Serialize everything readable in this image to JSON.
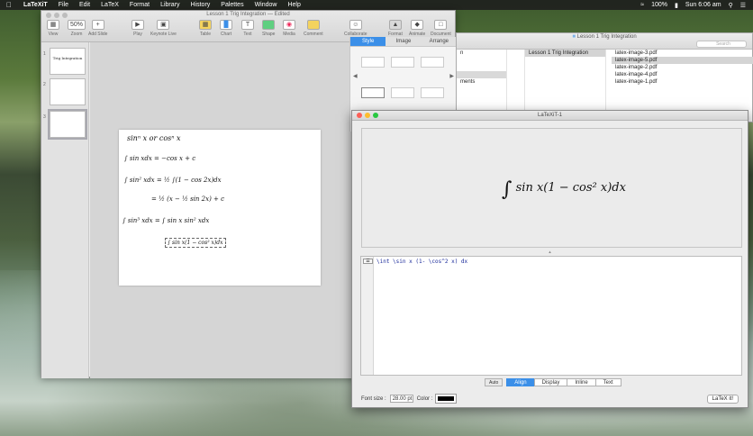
{
  "menubar": {
    "app": "LaTeXiT",
    "items": [
      "File",
      "Edit",
      "LaTeX",
      "Format",
      "Library",
      "History",
      "Palettes",
      "Window",
      "Help"
    ],
    "battery": "100%",
    "clock": "Sun 6:06 am"
  },
  "keynote": {
    "title": "Lesson 1 Trig Integration — Edited",
    "toolbar": [
      "View",
      "Zoom",
      "Add Slide",
      "Play",
      "Keynote Live",
      "Table",
      "Chart",
      "Text",
      "Shape",
      "Media",
      "Comment",
      "Collaborate",
      "Format",
      "Animate",
      "Document"
    ],
    "zoom": "50%",
    "slide_numbers": [
      "1",
      "2",
      "3"
    ],
    "slide1_title": "Trig Integration",
    "inspector_tabs": [
      "Style",
      "Image",
      "Arrange"
    ],
    "slide_lines": [
      "sinⁿ x  or  cosⁿ x",
      "∫ sin xdx = −cos x + c",
      "∫ sin² xdx = ½ ∫(1 − cos 2x)dx",
      "= ½ (x − ½ sin 2x) + c",
      "∫ sin³ xdx = ∫ sin x sin² xdx",
      "∫ sin x(1 − cos² x)dx"
    ]
  },
  "finder": {
    "title": "Lesson 1 Trig Integration",
    "search": "Search",
    "col1": [
      "n",
      "ments"
    ],
    "folder": "Lesson 1 Trig Integration",
    "files": [
      "latex-image-3.pdf",
      "latex-image-5.pdf",
      "latex-image-2.pdf",
      "latex-image-4.pdf",
      "latex-image-1.pdf"
    ]
  },
  "latexit": {
    "title": "LaTeXiT-1",
    "preview_formula": "sin x(1 − cos² x)dx",
    "source": "\\int \\sin x (1- \\cos^2 x) dx",
    "modes": [
      "Auto",
      "Align",
      "Display",
      "Inline",
      "Text"
    ],
    "active_mode": "Align",
    "font_size_label": "Font size :",
    "font_size": "28.00 pt",
    "color_label": "Color :",
    "latexit_button": "LaTeX it!"
  }
}
